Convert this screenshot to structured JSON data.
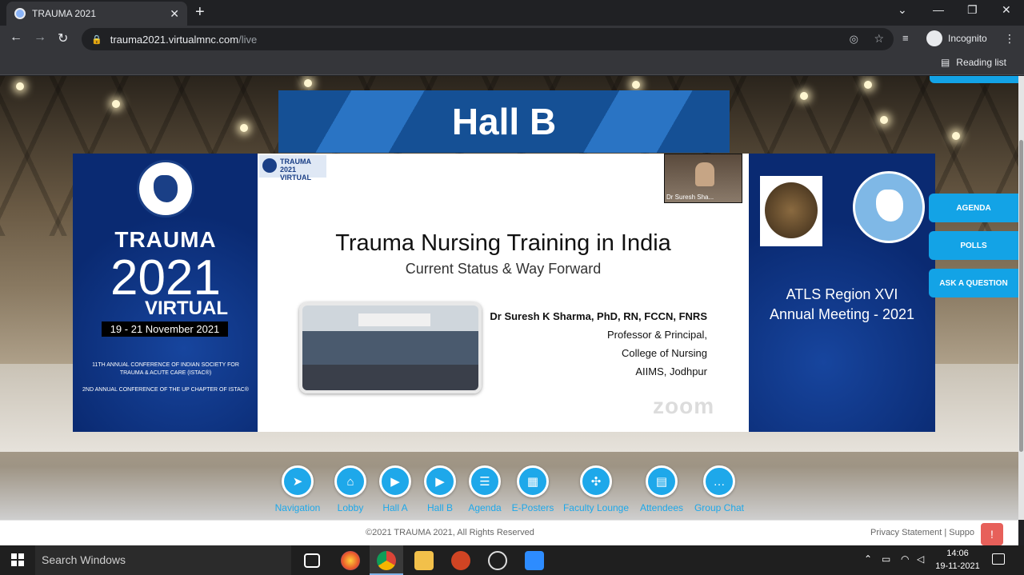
{
  "browser": {
    "tab_title": "TRAUMA 2021",
    "url_host": "trauma2021.virtualmnc.com",
    "url_path": "/live",
    "profile_label": "Incognito",
    "reading_list": "Reading list"
  },
  "banner": {
    "hall_title": "Hall B"
  },
  "left_panel": {
    "trauma": "TRAUMA",
    "year": "2021",
    "virtual": "VIRTUAL",
    "dates": "19 - 21 November 2021",
    "conf_line1": "11TH ANNUAL CONFERENCE OF INDIAN SOCIETY FOR TRAUMA & ACUTE CARE (ISTAC®)",
    "conf_line2": "2ND ANNUAL CONFERENCE OF THE UP CHAPTER OF ISTAC®"
  },
  "slide": {
    "logo_text": "TRAUMA 2021 VIRTUAL",
    "title": "Trauma Nursing Training in India",
    "subtitle": "Current Status & Way Forward",
    "speaker_name": "Dr Suresh K Sharma, PhD, RN, FCCN, FNRS",
    "speaker_role": "Professor & Principal,",
    "speaker_college": "College of Nursing",
    "speaker_inst": "AIIMS, Jodhpur",
    "watermark": "zoom",
    "video_label": "Dr Suresh Sha..."
  },
  "right_panel": {
    "atls_line1": "ATLS Region XVI",
    "atls_line2": "Annual Meeting - 2021"
  },
  "side_buttons": [
    "AGENDA",
    "POLLS",
    "ASK A QUESTION"
  ],
  "dock": [
    "Navigation",
    "Lobby",
    "Hall A",
    "Hall B",
    "Agenda",
    "E-Posters",
    "Faculty Lounge",
    "Attendees",
    "Group Chat"
  ],
  "footer": {
    "copyright": "©2021 TRAUMA 2021, All Rights Reserved",
    "links": "Privacy Statement | Suppo"
  },
  "taskbar": {
    "search_placeholder": "Search Windows",
    "time": "14:06",
    "date": "19-11-2021"
  }
}
